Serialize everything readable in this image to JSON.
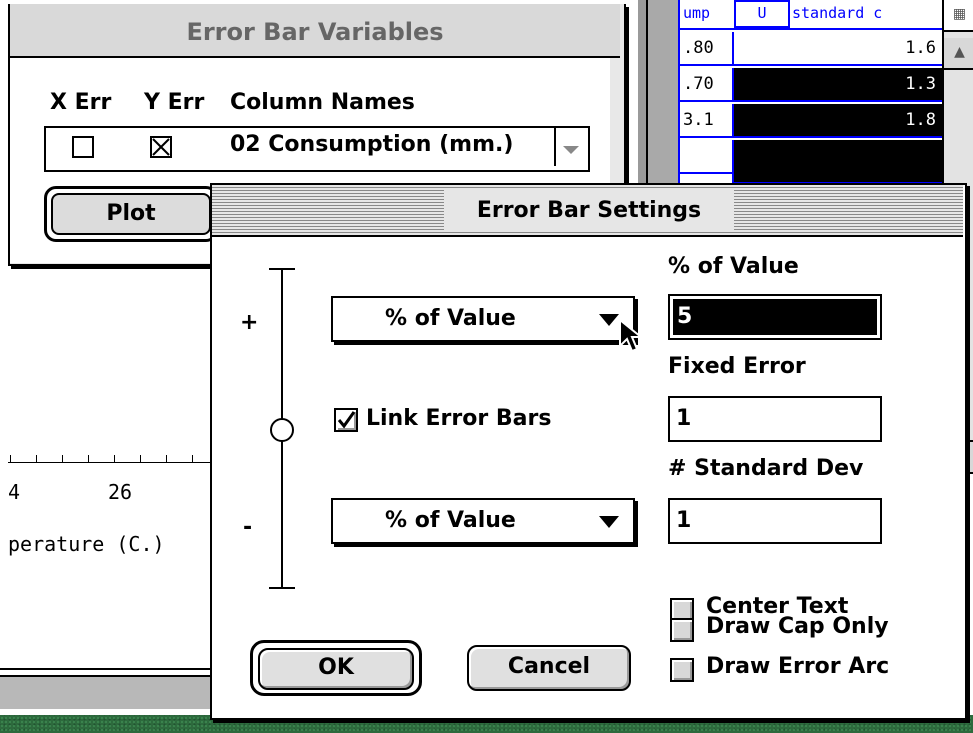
{
  "spreadsheet": {
    "headers": [
      "ump",
      "U",
      "standard c"
    ],
    "rows": [
      {
        "left": ".80",
        "value": "1.6",
        "selected": false
      },
      {
        "left": ".70",
        "value": "1.3",
        "selected": true
      },
      {
        "left": "3.1",
        "value": "1.8",
        "selected": true
      },
      {
        "left": "",
        "value": "",
        "selected": true
      }
    ]
  },
  "graph": {
    "tick_labels": [
      "4",
      "26"
    ],
    "xlabel": "perature (C.)"
  },
  "error_bar_variables": {
    "title": "Error Bar Variables",
    "col_x_err": "X Err",
    "col_y_err": "Y Err",
    "col_names": "Column Names",
    "row": {
      "x_checked": false,
      "y_checked": true,
      "name": "02 Consumption (mm.)"
    },
    "plot_button": "Plot"
  },
  "error_bar_settings": {
    "title": "Error Bar Settings",
    "plus_sign": "+",
    "minus_sign": "-",
    "upper_popup": "% of Value",
    "lower_popup": "% of Value",
    "link_label": "Link Error Bars",
    "link_checked": true,
    "pct_label": "% of Value",
    "pct_value": "5",
    "fixed_label": "Fixed Error",
    "fixed_value": "1",
    "std_label": "# Standard Dev",
    "std_value": "1",
    "center_text": "Center Text",
    "draw_cap_only": "Draw Cap Only",
    "draw_error_arc": "Draw Error Arc",
    "ok": "OK",
    "cancel": "Cancel"
  }
}
